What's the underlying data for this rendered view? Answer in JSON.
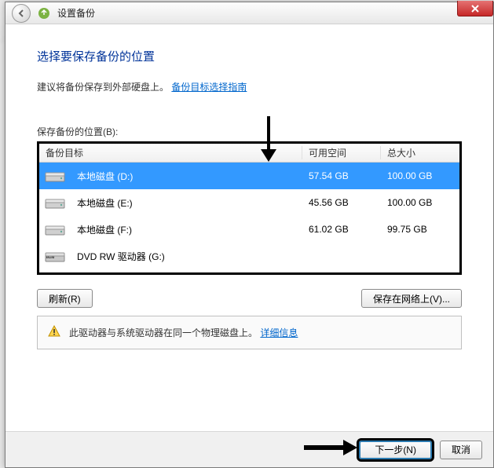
{
  "titlebar": {
    "header_label": "设置备份"
  },
  "main": {
    "heading": "选择要保存备份的位置",
    "subtext_prefix": "建议将备份保存到外部硬盘上。",
    "guide_link": "备份目标选择指南",
    "list_label": "保存备份的位置(B):"
  },
  "table": {
    "header": {
      "target": "备份目标",
      "free": "可用空间",
      "total": "总大小"
    },
    "rows": [
      {
        "name": "本地磁盘 (D:)",
        "free": "57.54 GB",
        "total": "100.00 GB",
        "icon": "hdd",
        "selected": true
      },
      {
        "name": "本地磁盘 (E:)",
        "free": "45.56 GB",
        "total": "100.00 GB",
        "icon": "hdd",
        "selected": false
      },
      {
        "name": "本地磁盘 (F:)",
        "free": "61.02 GB",
        "total": "99.75 GB",
        "icon": "hdd",
        "selected": false
      },
      {
        "name": "DVD RW 驱动器 (G:)",
        "free": "",
        "total": "",
        "icon": "dvd",
        "selected": false
      }
    ]
  },
  "buttons": {
    "refresh": "刷新(R)",
    "save_network": "保存在网络上(V)...",
    "next": "下一步(N)",
    "cancel": "取消"
  },
  "warning": {
    "text": "此驱动器与系统驱动器在同一个物理磁盘上。",
    "link": "详细信息"
  }
}
